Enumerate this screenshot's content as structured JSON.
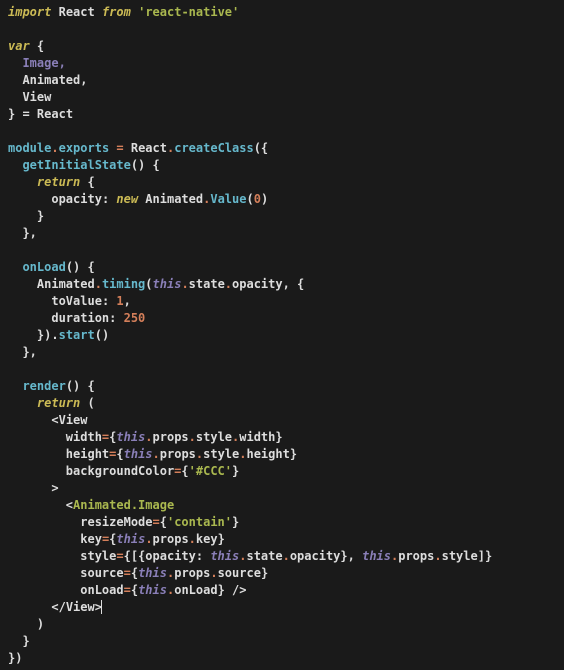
{
  "code": {
    "l1_import": "import",
    "l1_React": "React",
    "l1_from": "from",
    "l1_module": "'react-native'",
    "l3_var": "var",
    "l3_open": "{",
    "l4_Image": "Image,",
    "l5_Animated": "Animated,",
    "l6_View": "View",
    "l7_close_eq": "} =",
    "l7_React": "React",
    "l9_module": "module",
    "l9_dot1": ".",
    "l9_exports": "exports",
    "l9_eq": " = ",
    "l9_React": "React",
    "l9_dot2": ".",
    "l9_create": "createClass",
    "l9_paren": "({",
    "l10_getInit": "getInitialState",
    "l10_paren": "() {",
    "l11_return": "return",
    "l11_brace": " {",
    "l12_opacity": "opacity",
    "l12_colon": ": ",
    "l12_new": "new",
    "l12_Animated": " Animated",
    "l12_dot": ".",
    "l12_Value": "Value",
    "l12_paren": "(",
    "l12_zero": "0",
    "l12_close": ")",
    "l13_brace": "}",
    "l14_close": "},",
    "l16_onLoad": "onLoad",
    "l16_paren": "() {",
    "l17_Animated": "Animated",
    "l17_dot1": ".",
    "l17_timing": "timing",
    "l17_open": "(",
    "l17_this": "this",
    "l17_dot2": ".",
    "l17_state": "state",
    "l17_dot3": ".",
    "l17_opacity": "opacity",
    "l17_comma": ", {",
    "l18_toValue": "toValue",
    "l18_colon": ": ",
    "l18_one": "1",
    "l18_comma": ",",
    "l19_duration": "duration",
    "l19_colon": ": ",
    "l19_val": "250",
    "l20_close": "}).",
    "l20_start": "start",
    "l20_paren": "()",
    "l21_close": "},",
    "l23_render": "render",
    "l23_paren": "() {",
    "l24_return": "return",
    "l24_paren": " (",
    "l25_open": "<",
    "l25_View": "View",
    "l26_width": "width",
    "l26_eq": "=",
    "l26_open": "{",
    "l26_this": "this",
    "l26_dot1": ".",
    "l26_props": "props",
    "l26_dot2": ".",
    "l26_style": "style",
    "l26_dot3": ".",
    "l26_w": "width",
    "l26_close": "}",
    "l27_height": "height",
    "l27_eq": "=",
    "l27_open": "{",
    "l27_this": "this",
    "l27_dot1": ".",
    "l27_props": "props",
    "l27_dot2": ".",
    "l27_style": "style",
    "l27_dot3": ".",
    "l27_h": "height",
    "l27_close": "}",
    "l28_bg": "backgroundColor",
    "l28_eq": "=",
    "l28_open": "{",
    "l28_val": "'#CCC'",
    "l28_close": "}",
    "l29_gt": ">",
    "l30_open": "<",
    "l30_tag": "Animated.Image",
    "l31_resize": "resizeMode",
    "l31_eq": "=",
    "l31_open": "{",
    "l31_val": "'contain'",
    "l31_close": "}",
    "l32_key": "key",
    "l32_eq": "=",
    "l32_open": "{",
    "l32_this": "this",
    "l32_dot1": ".",
    "l32_props": "props",
    "l32_dot2": ".",
    "l32_k": "key",
    "l32_close": "}",
    "l33_style": "style",
    "l33_eq": "=",
    "l33_open": "{[{",
    "l33_opacity": "opacity",
    "l33_colon": ": ",
    "l33_this1": "this",
    "l33_dot1": ".",
    "l33_state": "state",
    "l33_dot2": ".",
    "l33_opac": "opacity",
    "l33_mid": "}, ",
    "l33_this2": "this",
    "l33_dot3": ".",
    "l33_props": "props",
    "l33_dot4": ".",
    "l33_st": "style",
    "l33_close": "]}",
    "l34_source": "source",
    "l34_eq": "=",
    "l34_open": "{",
    "l34_this": "this",
    "l34_dot1": ".",
    "l34_props": "props",
    "l34_dot2": ".",
    "l34_src": "source",
    "l34_close": "}",
    "l35_onLoad": "onLoad",
    "l35_eq": "=",
    "l35_open": "{",
    "l35_this": "this",
    "l35_dot": ".",
    "l35_ol": "onLoad",
    "l35_close": "} />",
    "l36_closeView": "</",
    "l36_View": "View",
    "l36_gt": ">",
    "l37_paren": ")",
    "l38_brace": "}",
    "l39_close": "})"
  }
}
